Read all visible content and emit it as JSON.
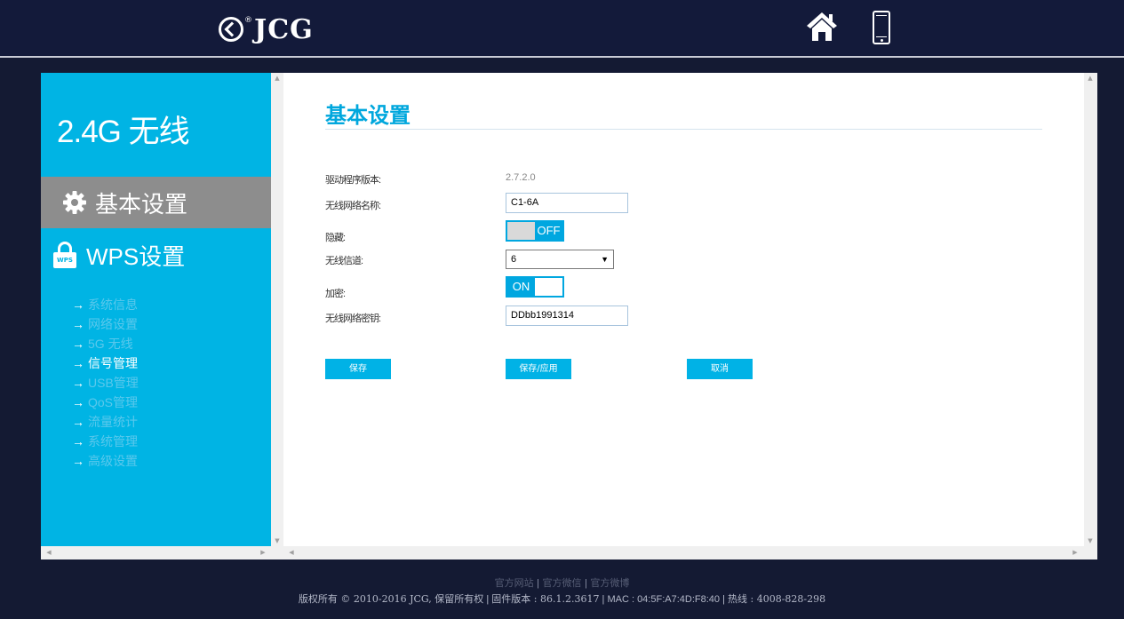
{
  "header": {
    "logo_text": "JCG",
    "logo_reg": "®"
  },
  "sidebar": {
    "title": "2.4G 无线",
    "menu_basic": "基本设置",
    "menu_wps": "WPS设置",
    "wps_badge": "WPS",
    "submenu": [
      {
        "label": "系统信息",
        "active": false
      },
      {
        "label": "网络设置",
        "active": false
      },
      {
        "label": "5G 无线",
        "active": false
      },
      {
        "label": "信号管理",
        "active": true
      },
      {
        "label": "USB管理",
        "active": false
      },
      {
        "label": "QoS管理",
        "active": false
      },
      {
        "label": "流量统计",
        "active": false
      },
      {
        "label": "系统管理",
        "active": false
      },
      {
        "label": "高级设置",
        "active": false
      }
    ],
    "arrow": "→"
  },
  "main": {
    "title": "基本设置",
    "fields": {
      "driver_label": "驱动程序版本:",
      "driver_value": "2.7.2.0",
      "ssid_label": "无线网络名称:",
      "ssid_value": "C1-6A",
      "hidden_label": "隐藏:",
      "hidden_toggle": "OFF",
      "channel_label": "无线信道:",
      "channel_value": "6",
      "encrypt_label": "加密:",
      "encrypt_toggle": "ON",
      "key_label": "无线网络密钥:",
      "key_value": "DDbb1991314"
    },
    "buttons": {
      "save": "保存",
      "save_apply": "保存/应用",
      "cancel": "取消"
    }
  },
  "footer": {
    "link_official_site": "官方网站",
    "link_wechat": "官方微信",
    "link_weibo": "官方微博",
    "separator": "|",
    "copyright": "版权所有 © 2010-2016 JCG, 保留所有权",
    "firmware": "固件版本 : 86.1.2.3617",
    "mac": "MAC : 04:5F:A7:4D:F8:40",
    "hotline": "热线 : 4008-828-298"
  },
  "colors": {
    "accent": "#00b4e4",
    "header_bg": "#131a3a",
    "active_menu_bg": "#8d8d8d"
  }
}
